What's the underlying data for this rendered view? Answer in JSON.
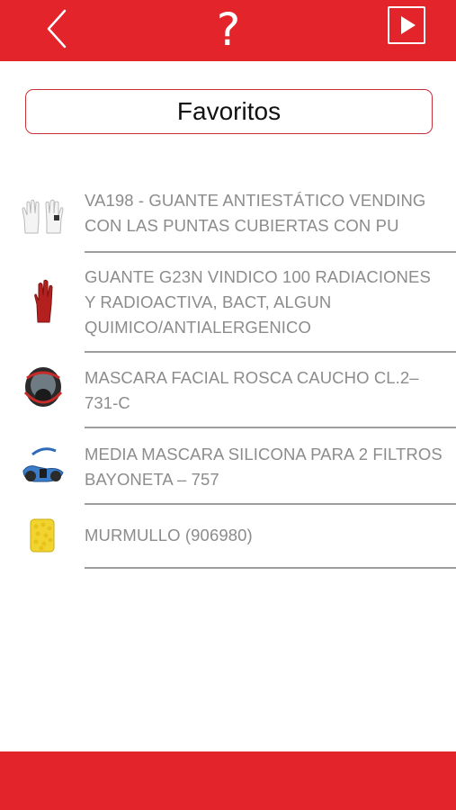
{
  "header": {
    "back_icon": "chevron-left-icon",
    "help_label": "?",
    "play_icon": "play-icon"
  },
  "title": "Favoritos",
  "favorites": [
    {
      "label": "VA198 - GUANTE ANTIESTÁTICO VENDING CON LAS PUNTAS CUBIERTAS CON PU",
      "thumb": "white-gloves"
    },
    {
      "label": "GUANTE G23N VINDICO 100 RADIACIONES Y RADIOACTIVA, BACT, ALGUN QUIMICO/ANTIALERGENICO",
      "thumb": "red-glove"
    },
    {
      "label": "MASCARA FACIAL ROSCA CAUCHO CL.2–731-C",
      "thumb": "full-face-mask"
    },
    {
      "label": "MEDIA MASCARA SILICONA PARA 2 FILTROS BAYONETA – 757",
      "thumb": "half-mask"
    },
    {
      "label": "MURMULLO (906980)",
      "thumb": "earplugs"
    }
  ],
  "colors": {
    "accent": "#e3242b",
    "text_muted": "#8c8c8c",
    "divider": "#9e9e9e"
  }
}
